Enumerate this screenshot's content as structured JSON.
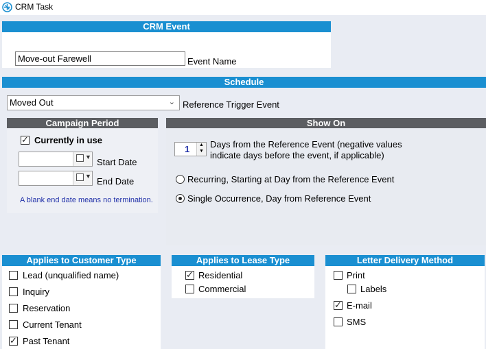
{
  "window": {
    "title": "CRM Task"
  },
  "crm_event": {
    "header": "CRM Event",
    "event_name_value": "Move-out Farewell",
    "event_name_label": "Event Name"
  },
  "schedule": {
    "header": "Schedule",
    "trigger_value": "Moved Out",
    "trigger_label": "Reference Trigger Event"
  },
  "campaign": {
    "header": "Campaign Period",
    "currently_in_use_label": "Currently in use",
    "currently_in_use_checked": true,
    "start_date_label": "Start Date",
    "end_date_label": "End Date",
    "note": "A blank end date means no termination."
  },
  "show_on": {
    "header": "Show On",
    "days_value": "1",
    "days_label_line1": "Days from the Reference Event (negative values",
    "days_label_line2": "indicate days before the event, if applicable)",
    "recurring_label": "Recurring, Starting at Day from the Reference Event",
    "single_label": "Single Occurrence, Day from Reference Event",
    "selected": "single"
  },
  "customer_type": {
    "header": "Applies to Customer Type",
    "items": [
      {
        "label": "Lead  (unqualified name)",
        "checked": false
      },
      {
        "label": "Inquiry",
        "checked": false
      },
      {
        "label": "Reservation",
        "checked": false
      },
      {
        "label": "Current Tenant",
        "checked": false
      },
      {
        "label": "Past Tenant",
        "checked": true
      }
    ]
  },
  "lease_type": {
    "header": "Applies to Lease Type",
    "items": [
      {
        "label": "Residential",
        "checked": true
      },
      {
        "label": "Commercial",
        "checked": false
      }
    ]
  },
  "delivery": {
    "header": "Letter Delivery Method",
    "items": [
      {
        "label": "Print",
        "checked": false
      },
      {
        "label": "Labels",
        "checked": false
      },
      {
        "label": "E-mail",
        "checked": true
      },
      {
        "label": "SMS",
        "checked": false
      }
    ]
  },
  "colors": {
    "accent_blue": "#1a8fd1",
    "header_gray": "#5b5d61",
    "note_blue": "#1f2fa8"
  }
}
